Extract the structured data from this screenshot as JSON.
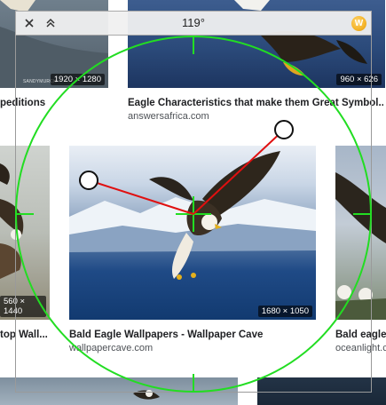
{
  "grid": {
    "row1": {
      "left": {
        "dimensions": "1920 × 1280",
        "credit": "SANDYMURCH",
        "title": "peditions"
      },
      "right": {
        "dimensions": "960 × 626",
        "title": "Eagle Characteristics that make them Great Symbol...",
        "source": "answersafrica.com"
      }
    },
    "row2": {
      "left": {
        "dimensions": "560 × 1440",
        "title": "top Wall..."
      },
      "center": {
        "dimensions": "1680 × 1050",
        "title": "Bald Eagle Wallpapers - Wallpaper Cave",
        "source": "wallpapercave.com"
      },
      "right": {
        "title": "Bald eagle",
        "source": "oceanlight.c"
      }
    }
  },
  "protractor": {
    "angle": "119°",
    "logo_letter": "W",
    "colors": {
      "circle": "#22dd22",
      "arms": "#e01010"
    }
  },
  "icons": {
    "close": "close-icon",
    "collapse": "double-chevron-up-icon",
    "logo": "app-logo-icon"
  }
}
